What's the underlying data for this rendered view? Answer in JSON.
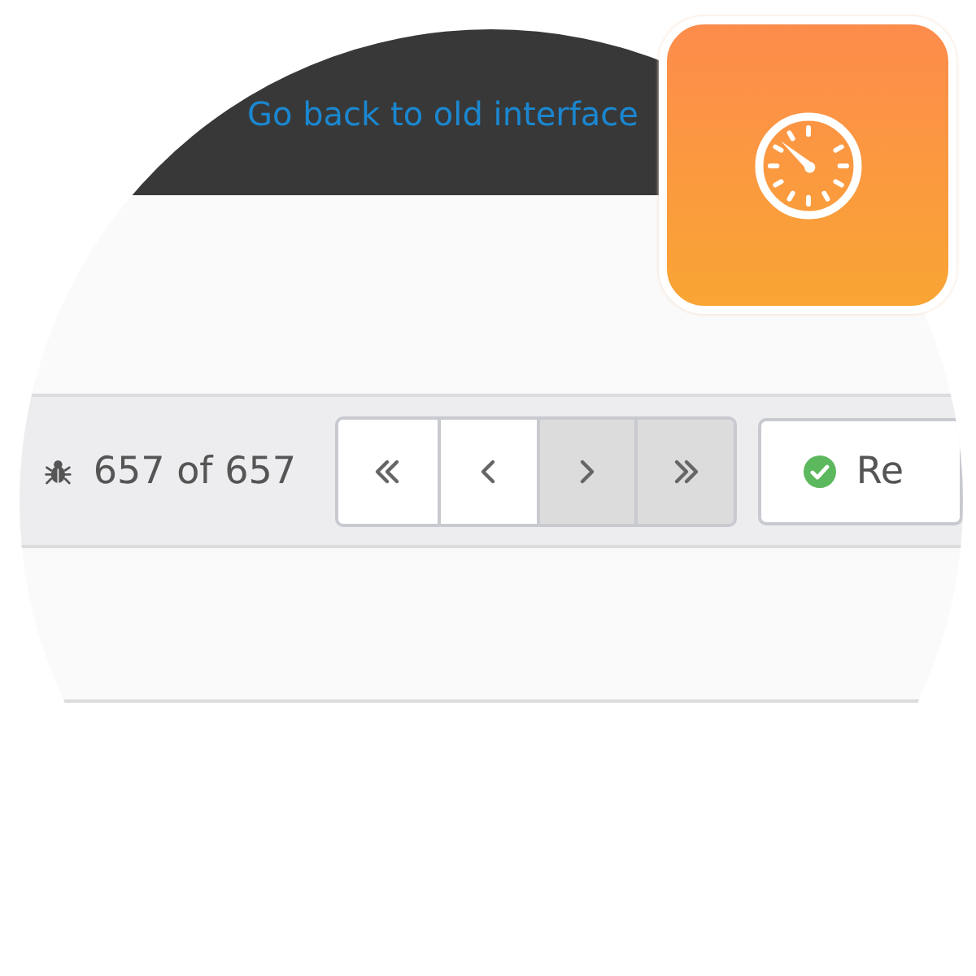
{
  "banner": {
    "link": "Go back to old interface"
  },
  "toolbar": {
    "count": "657 of 657",
    "pager": [
      {
        "kind": "first",
        "disabled": false
      },
      {
        "kind": "prev",
        "disabled": false
      },
      {
        "kind": "next",
        "disabled": true
      },
      {
        "kind": "last",
        "disabled": true
      }
    ],
    "status_button": {
      "label": "Re"
    }
  }
}
